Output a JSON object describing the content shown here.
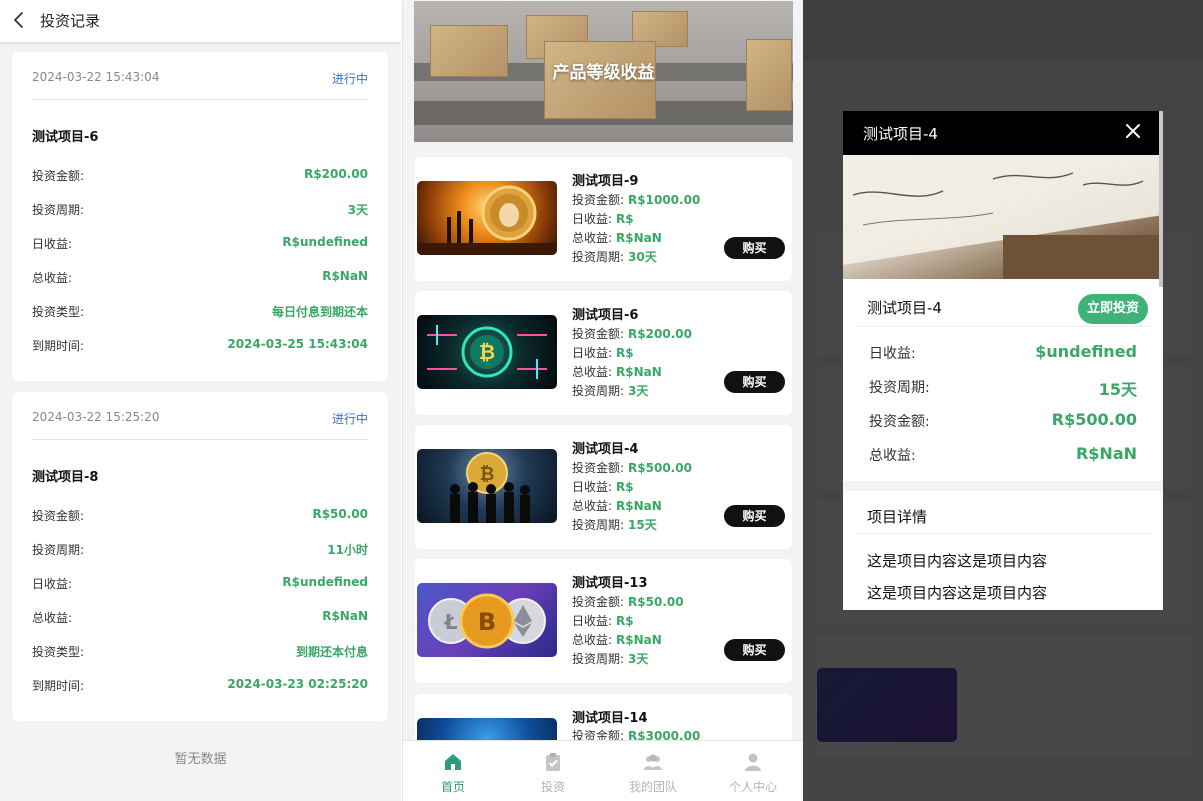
{
  "records_page": {
    "title": "投资记录",
    "records": [
      {
        "date": "2024-03-22 15:43:04",
        "status": "进行中",
        "name": "测试项目-6",
        "rows": [
          {
            "label": "投资金额:",
            "value": "R$200.00"
          },
          {
            "label": "投资周期:",
            "value": "3天"
          },
          {
            "label": "日收益:",
            "value": "R$undefined"
          },
          {
            "label": "总收益:",
            "value": "R$NaN"
          },
          {
            "label": "投资类型:",
            "value": "每日付息到期还本"
          },
          {
            "label": "到期时间:",
            "value": "2024-03-25 15:43:04"
          }
        ]
      },
      {
        "date": "2024-03-22 15:25:20",
        "status": "进行中",
        "name": "测试项目-8",
        "rows": [
          {
            "label": "投资金额:",
            "value": "R$50.00"
          },
          {
            "label": "投资周期:",
            "value": "11小时"
          },
          {
            "label": "日收益:",
            "value": "R$undefined"
          },
          {
            "label": "总收益:",
            "value": "R$NaN"
          },
          {
            "label": "投资类型:",
            "value": "到期还本付息"
          },
          {
            "label": "到期时间:",
            "value": "2024-03-23 02:25:20"
          }
        ]
      }
    ],
    "empty_text": "暂无数据"
  },
  "home": {
    "banner_title": "产品等级收益",
    "labels": {
      "amount": "投资金额:",
      "daily": "日收益:",
      "total": "总收益:",
      "period": "投资周期:",
      "buy": "购买"
    },
    "products": [
      {
        "name": "测试项目-9",
        "amount": "R$1000.00",
        "daily": "R$",
        "total": "R$NaN",
        "period": "30天",
        "image": "dogecoin-image"
      },
      {
        "name": "测试项目-6",
        "amount": "R$200.00",
        "daily": "R$",
        "total": "R$NaN",
        "period": "3天",
        "image": "bitcoin-circuit-image"
      },
      {
        "name": "测试项目-4",
        "amount": "R$500.00",
        "daily": "R$",
        "total": "R$NaN",
        "period": "15天",
        "image": "bitcoin-business-image"
      },
      {
        "name": "测试项目-13",
        "amount": "R$50.00",
        "daily": "R$",
        "total": "R$NaN",
        "period": "3天",
        "image": "crypto-coins-image"
      },
      {
        "name": "测试项目-14",
        "amount": "R$3000.00",
        "daily": "",
        "total": "",
        "period": "",
        "image": "blue-network-image"
      }
    ],
    "tabs": [
      {
        "label": "首页",
        "icon": "home-icon",
        "active": true
      },
      {
        "label": "投资",
        "icon": "clipboard-icon",
        "active": false
      },
      {
        "label": "我的团队",
        "icon": "team-icon",
        "active": false
      },
      {
        "label": "个人中心",
        "icon": "user-icon",
        "active": false
      }
    ]
  },
  "modal": {
    "title": "测试项目-4",
    "product_name": "测试项目-4",
    "invest_button": "立即投资",
    "rows": [
      {
        "label": "日收益:",
        "value": "$undefined"
      },
      {
        "label": "投资周期:",
        "value": "15天"
      },
      {
        "label": "投资金额:",
        "value": "R$500.00"
      },
      {
        "label": "总收益:",
        "value": "R$NaN"
      }
    ],
    "detail_title": "项目详情",
    "detail_lines": [
      "这是项目内容这是项目内容",
      "这是项目内容这是项目内容"
    ],
    "image": "check-writing-image"
  },
  "colors": {
    "accent_green": "#3aa766",
    "status_blue": "#3b6fd8",
    "invest_button": "#3fb27a",
    "tab_active": "#2f9c7c"
  }
}
